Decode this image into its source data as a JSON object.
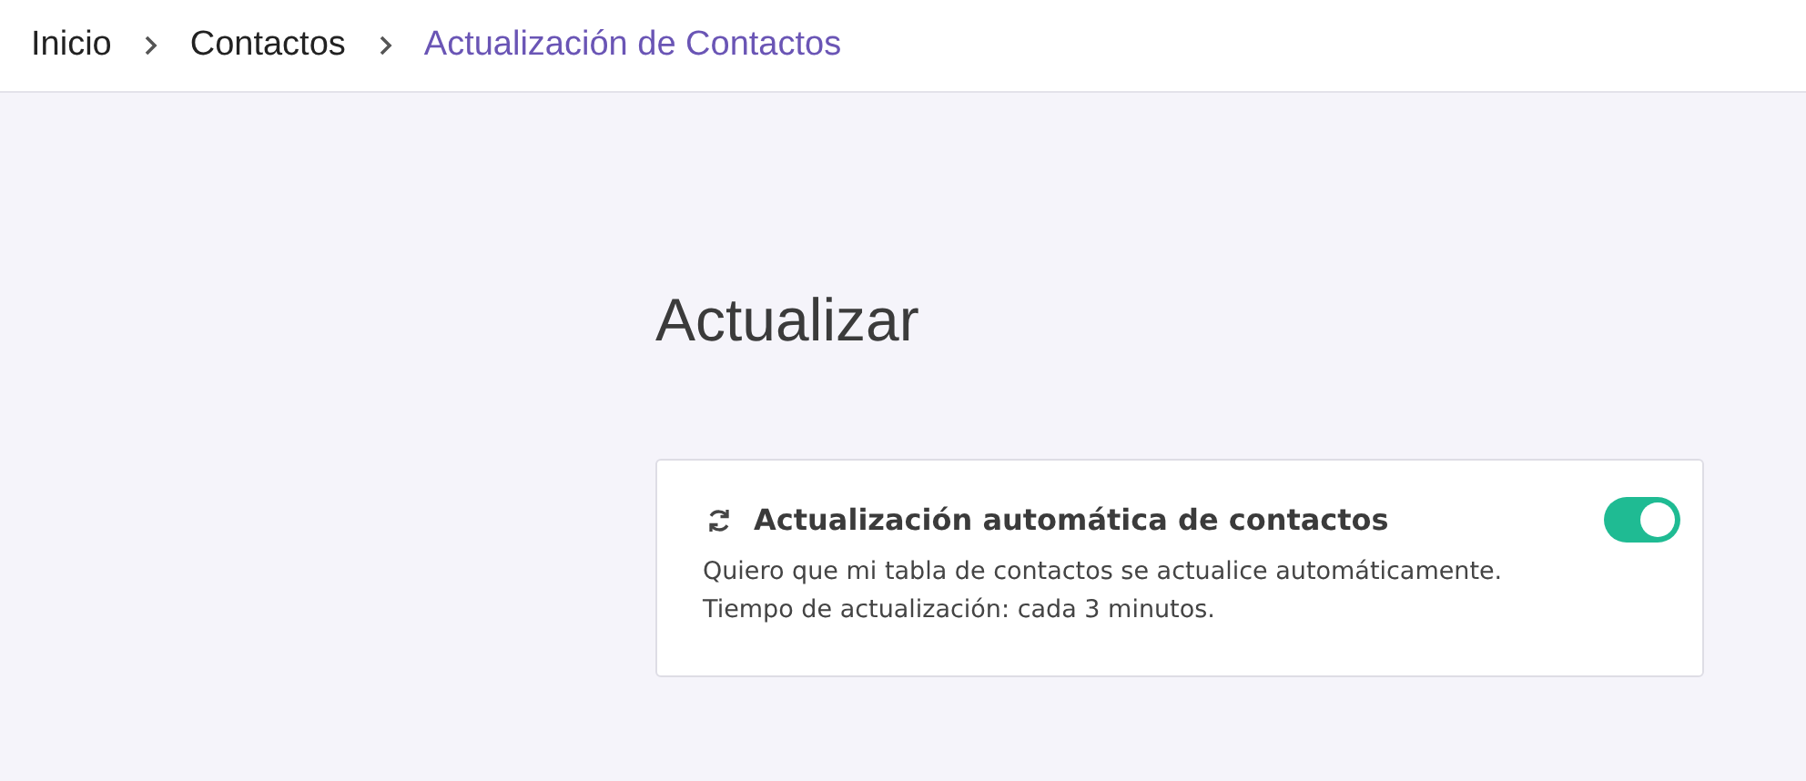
{
  "breadcrumb": [
    {
      "label": "Inicio",
      "current": false
    },
    {
      "label": "Contactos",
      "current": false
    },
    {
      "label": "Actualización de Contactos",
      "current": true
    }
  ],
  "page_title": "Actualizar",
  "setting_card": {
    "title": "Actualización automática de contactos",
    "on": true,
    "description": [
      "Quiero que mi tabla de contactos se actualice automáticamente.",
      "Tiempo de actualización: cada 3 minutos."
    ]
  }
}
